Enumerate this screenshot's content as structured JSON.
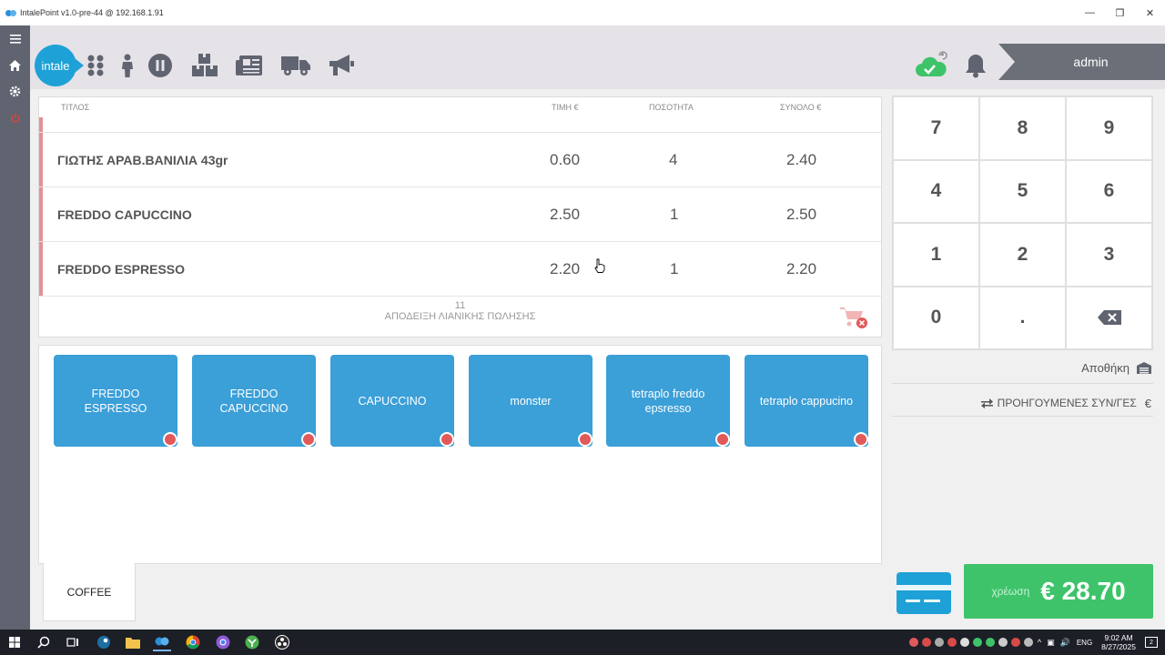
{
  "window": {
    "title": "IntalePoint v1.0-pre-44 @ 192.168.1.91"
  },
  "brand": {
    "logo_text": "intale"
  },
  "user": {
    "name": "admin"
  },
  "order_table": {
    "headers": {
      "title": "ΤΙΤΛΟΣ",
      "price": "ΤΙΜΗ €",
      "quantity": "ΠΟΣΟΤΗΤΑ",
      "total": "ΣΥΝΟΛΟ €"
    },
    "rows": [
      {
        "title": "ΓΙΩΤΗΣ ΑΡΑΒ.ΒΑΝΙΛΙΑ 43gr",
        "price": "0.60",
        "quantity": "4",
        "total": "2.40"
      },
      {
        "title": "FREDDO CAPUCCINO",
        "price": "2.50",
        "quantity": "1",
        "total": "2.50"
      },
      {
        "title": "FREDDO ESPRESSO",
        "price": "2.20",
        "quantity": "1",
        "total": "2.20"
      }
    ],
    "receipt_number": "11",
    "receipt_type": "ΑΠΟΔΕΙΞΗ ΛΙΑΝΙΚΗΣ ΠΩΛΗΣΗΣ"
  },
  "products": [
    {
      "label": "FREDDO ESPRESSO"
    },
    {
      "label": "FREDDO CAPUCCINO"
    },
    {
      "label": "CAPUCCINO"
    },
    {
      "label": "monster"
    },
    {
      "label": "tetraplo freddo epsresso"
    },
    {
      "label": "tetraplo cappucino"
    }
  ],
  "category_tab": {
    "label": "COFFEE"
  },
  "numpad": {
    "keys": [
      "7",
      "8",
      "9",
      "4",
      "5",
      "6",
      "1",
      "2",
      "3",
      "0",
      ".",
      "⌫"
    ]
  },
  "side_actions": {
    "storage": "Αποθήκη",
    "previous_transactions": "ΠΡΟΗΓΟΥΜΕΝΕΣ ΣΥΝ/ΓΕΣ"
  },
  "charge": {
    "label": "χρέωση",
    "amount": "€ 28.70"
  },
  "taskbar": {
    "time": "9:02 AM",
    "date": "8/27/2025",
    "language": "ENG",
    "notifications": "2"
  },
  "colors": {
    "accent": "#3b9fd8",
    "charge": "#3ec36a",
    "brand": "#1ea1d6",
    "row_marker": "#e39096"
  }
}
